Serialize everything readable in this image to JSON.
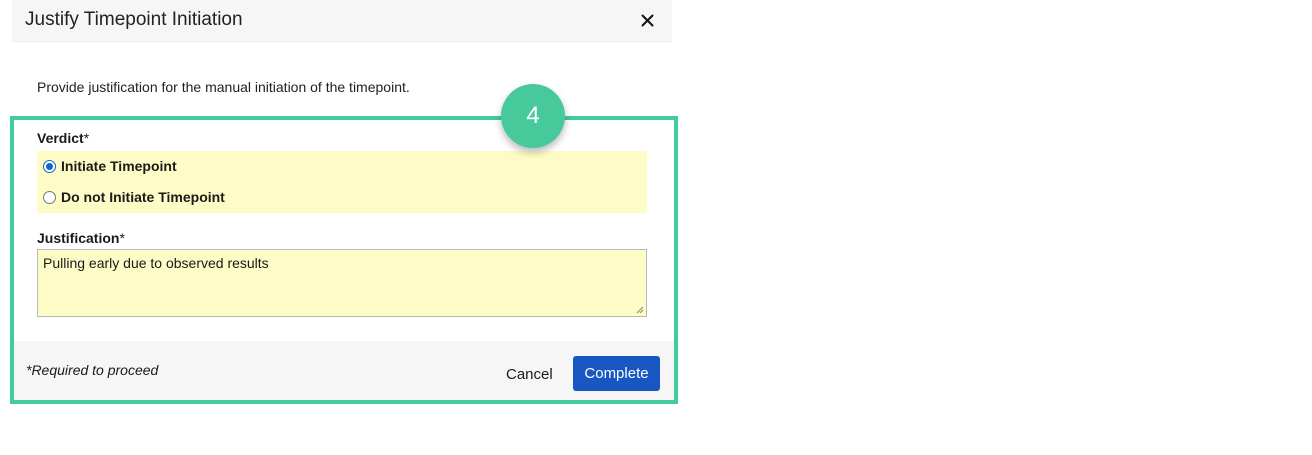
{
  "dialog": {
    "title": "Justify Timepoint Initiation",
    "close_icon": "close-icon",
    "intro": "Provide justification for the manual initiation of the timepoint."
  },
  "step_badge": "4",
  "verdict": {
    "label": "Verdict",
    "required_mark": "*",
    "options": [
      {
        "label": "Initiate Timepoint",
        "selected": true
      },
      {
        "label": "Do not Initiate Timepoint",
        "selected": false
      }
    ]
  },
  "justification": {
    "label": "Justification",
    "required_mark": "*",
    "value": "Pulling early due to observed results"
  },
  "footer": {
    "note": "*Required to proceed",
    "cancel_label": "Cancel",
    "complete_label": "Complete"
  },
  "colors": {
    "highlight_border": "#42cc9b",
    "badge": "#47c99b",
    "field_background": "#fdfcc7",
    "primary_button": "#1857c2",
    "radio_accent": "#0a66d1"
  }
}
